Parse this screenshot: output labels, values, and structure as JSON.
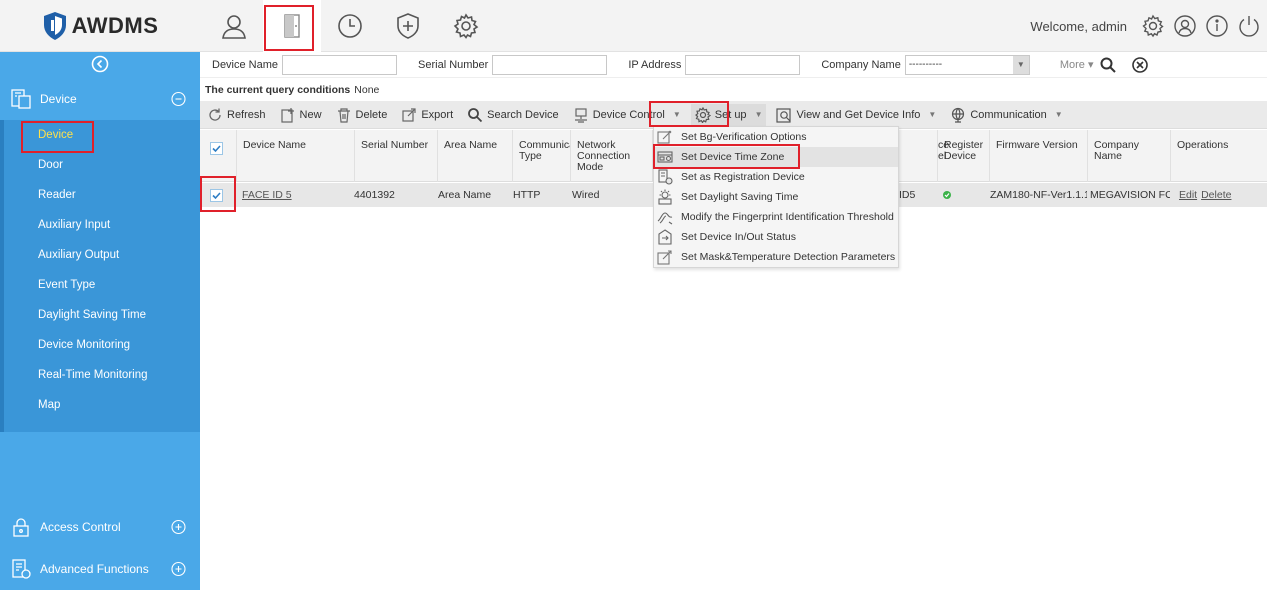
{
  "app": {
    "name": "AWDMS"
  },
  "header": {
    "nav": [
      {
        "name": "personnel-icon"
      },
      {
        "name": "door-icon"
      },
      {
        "name": "clock-icon"
      },
      {
        "name": "medical-cross-icon"
      },
      {
        "name": "gear-icon"
      }
    ],
    "welcome": "Welcome, admin"
  },
  "sidebar": {
    "sections": {
      "device": "Device",
      "access_control": "Access Control",
      "advanced": "Advanced Functions"
    },
    "items": [
      "Device",
      "Door",
      "Reader",
      "Auxiliary Input",
      "Auxiliary Output",
      "Event Type",
      "Daylight Saving Time",
      "Device Monitoring",
      "Real-Time Monitoring",
      "Map"
    ]
  },
  "filter": {
    "device_name": "Device Name",
    "serial_number": "Serial Number",
    "ip_address": "IP Address",
    "company_name": "Company Name",
    "company_value": "----------",
    "more": "More"
  },
  "query": {
    "label": "The current query conditions",
    "value": "None"
  },
  "toolbar": {
    "refresh": "Refresh",
    "new": "New",
    "delete": "Delete",
    "export": "Export",
    "search_device": "Search Device",
    "device_control": "Device Control",
    "setup": "Set up",
    "view_info": "View and Get Device Info",
    "communication": "Communication"
  },
  "table": {
    "headers": {
      "device_name": "Device Name",
      "serial": "Serial Number",
      "area": "Area Name",
      "comm_type": "Communica Type",
      "network": "Network Connection Mode",
      "device_model": "ce el",
      "register": "Register Device",
      "firmware": "Firmware Version",
      "company": "Company Name",
      "operations": "Operations"
    },
    "rows": [
      {
        "device_name": "FACE ID 5",
        "serial": "4401392",
        "area": "Area Name",
        "comm_type": "HTTP",
        "network": "Wired",
        "device_model": "ID5",
        "firmware": "ZAM180-NF-Ver1.1.1",
        "company": "MEGAVISION FO",
        "edit": "Edit",
        "delete": "Delete"
      }
    ]
  },
  "setup_menu": [
    "Set Bg-Verification Options",
    "Set Device Time Zone",
    "Set as Registration Device",
    "Set Daylight Saving Time",
    "Modify the Fingerprint Identification Threshold",
    "Set Device In/Out Status",
    "Set Mask&Temperature Detection Parameters"
  ],
  "colors": {
    "sidebar": "#4aa8e8",
    "sidebar_sub": "#3a96d8",
    "active_item": "#ffe14a",
    "highlight": "#e0202a"
  }
}
